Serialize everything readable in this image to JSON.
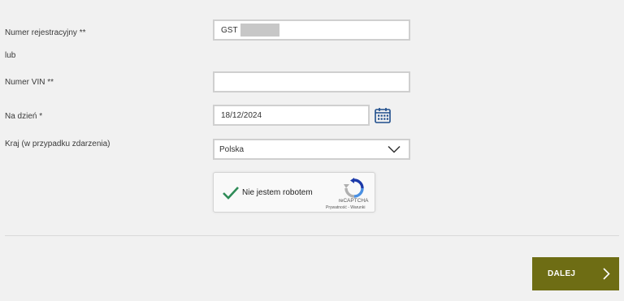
{
  "form": {
    "registration": {
      "label": "Numer rejestracyjny **",
      "value": "GST"
    },
    "or_text": "lub",
    "vin": {
      "label": "Numer VIN **",
      "value": ""
    },
    "date": {
      "label": "Na dzień  *",
      "value": "18/12/2024",
      "icon": "calendar-icon"
    },
    "country": {
      "label": "Kraj (w przypadku zdarzenia)",
      "value": "Polska",
      "icon": "chevron-down-icon"
    }
  },
  "captcha": {
    "label": "Nie jestem robotem",
    "checked": true,
    "brand": "reCAPTCHA",
    "privacy": "Prywatność",
    "separator": " - ",
    "terms": "Warunki"
  },
  "actions": {
    "next_label": "DALEJ",
    "next_icon": "chevron-right-icon"
  },
  "colors": {
    "background": "#f1f1f1",
    "button": "#6e6d14",
    "field_border": "#cfcfcf",
    "calendar": "#1f4e8c",
    "check": "#2e8b57"
  }
}
